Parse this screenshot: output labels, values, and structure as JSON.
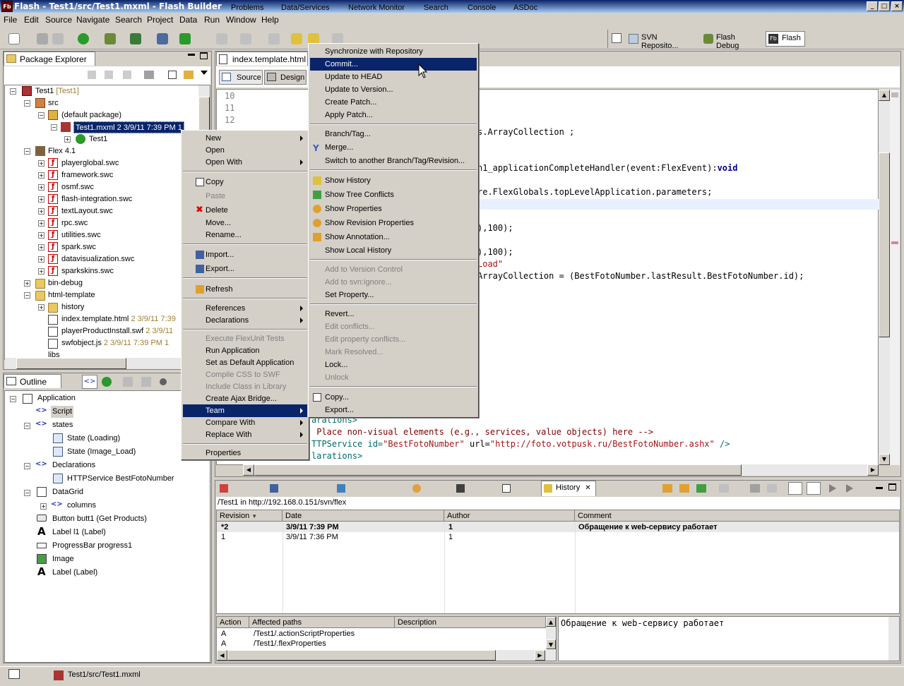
{
  "window": {
    "title": "Flash - Test1/src/Test1.mxml - Flash Builder",
    "icon_text": "Fb"
  },
  "menubar": [
    "File",
    "Edit",
    "Source",
    "Navigate",
    "Search",
    "Project",
    "Data",
    "Run",
    "Window",
    "Help"
  ],
  "perspectives": [
    "SVN Reposito...",
    "Flash Debug",
    "Flash"
  ],
  "package_explorer": {
    "tab": "Package Explorer",
    "items": [
      {
        "label": "Test1",
        "suffix": "[Test1]"
      },
      {
        "label": "src"
      },
      {
        "label": "(default package)"
      },
      {
        "label": "Test1.mxml 2  3/9/11 7:39 PM  1"
      },
      {
        "label": "Test1"
      },
      {
        "label": "Flex 4.1"
      },
      {
        "label": "playerglobal.swc"
      },
      {
        "label": "framework.swc"
      },
      {
        "label": "osmf.swc"
      },
      {
        "label": "flash-integration.swc"
      },
      {
        "label": "textLayout.swc"
      },
      {
        "label": "rpc.swc"
      },
      {
        "label": "utilities.swc"
      },
      {
        "label": "spark.swc"
      },
      {
        "label": "datavisualization.swc"
      },
      {
        "label": "sparkskins.swc"
      },
      {
        "label": "bin-debug"
      },
      {
        "label": "html-template"
      },
      {
        "label": "history"
      },
      {
        "label": "index.template.html",
        "suffix": "2  3/9/11 7:39"
      },
      {
        "label": "playerProductInstall.swf",
        "suffix": "2  3/9/11"
      },
      {
        "label": "swfobject.js",
        "suffix": "2  3/9/11 7:39 PM  1"
      },
      {
        "label": "libs"
      }
    ]
  },
  "outline": {
    "tab": "Outline",
    "items": [
      "Application",
      "Script",
      "states",
      "State (Loading)",
      "State (Image_Load)",
      "Declarations",
      "HTTPService BestFotoNumber",
      "DataGrid",
      "columns",
      "Button butt1 (Get Products)",
      "Label l1 (Label)",
      "ProgressBar progress1",
      "Image",
      "Label (Label)"
    ]
  },
  "editor": {
    "tab": "index.template.html",
    "source_btn": "Source",
    "design_btn": "Design",
    "line_numbers": [
      "10",
      "11",
      "12"
    ],
    "code_fragments": {
      "l1": "s.ArrayCollection ;",
      "l2a": "n1_applicationCompleteHandler(event:FlexEvent):",
      "l2b": "void",
      "l3": "re.FlexGlobals.topLevelApplication.parameters;",
      "l4": "),100);",
      "l5": "),100);",
      "l6": "Load\"",
      "l7": "ArrayCollection = (BestFotoNumber.lastResult.BestFotoNumber.id);",
      "l8": "arations>",
      "l9": " Place non-visual elements (e.g., services, value objects) here -->",
      "l10a": "TTPService id=",
      "l10b": "\"BestFotoNumber\"",
      "l10c": " url=",
      "l10d": "\"http://foto.votpusk.ru/BestFotoNumber.ashx\"",
      "l10e": " />",
      "l11": "larations>"
    }
  },
  "context_menu": {
    "items": [
      "New",
      "Open",
      "Open With",
      "Copy",
      "Paste",
      "Delete",
      "Move...",
      "Rename...",
      "Import...",
      "Export...",
      "Refresh",
      "References",
      "Declarations",
      "Execute FlexUnit Tests",
      "Run Application",
      "Set as Default Application",
      "Compile CSS to SWF",
      "Include Class in Library",
      "Create Ajax Bridge...",
      "Team",
      "Compare With",
      "Replace With",
      "Properties"
    ]
  },
  "team_menu": {
    "items": [
      "Synchronize with Repository",
      "Commit...",
      "Update to HEAD",
      "Update to Version...",
      "Create Patch...",
      "Apply Patch...",
      "Branch/Tag...",
      "Merge...",
      "Switch to another Branch/Tag/Revision...",
      "Show History",
      "Show Tree Conflicts",
      "Show Properties",
      "Show Revision Properties",
      "Show Annotation...",
      "Show Local History",
      "Add to Version Control",
      "Add to svn:ignore...",
      "Set Property...",
      "Revert...",
      "Edit conflicts...",
      "Edit property conflicts...",
      "Mark Resolved...",
      "Lock...",
      "Unlock",
      "Copy...",
      "Export..."
    ]
  },
  "bottom_tabs": [
    "Problems",
    "Data/Services",
    "Network Monitor",
    "Search",
    "Console",
    "ASDoc",
    "History"
  ],
  "history": {
    "path": "/Test1 in http://192.168.0.151/svn/flex",
    "columns": [
      "Revision",
      "Date",
      "Author",
      "Comment"
    ],
    "rows": [
      {
        "rev": "*2",
        "date": "3/9/11 7:39 PM",
        "author": "1",
        "comment": "Обращение к web-сервису работает"
      },
      {
        "rev": "1",
        "date": "3/9/11 7:36 PM",
        "author": "1",
        "comment": ""
      }
    ],
    "paths_columns": [
      "Action",
      "Affected paths",
      "Description"
    ],
    "paths_rows": [
      {
        "action": "A",
        "path": "/Test1/.actionScriptProperties"
      },
      {
        "action": "A",
        "path": "/Test1/.flexProperties"
      }
    ],
    "comment_text": "Обращение к web-сервису работает"
  },
  "statusbar": {
    "path": "Test1/src/Test1.mxml"
  }
}
